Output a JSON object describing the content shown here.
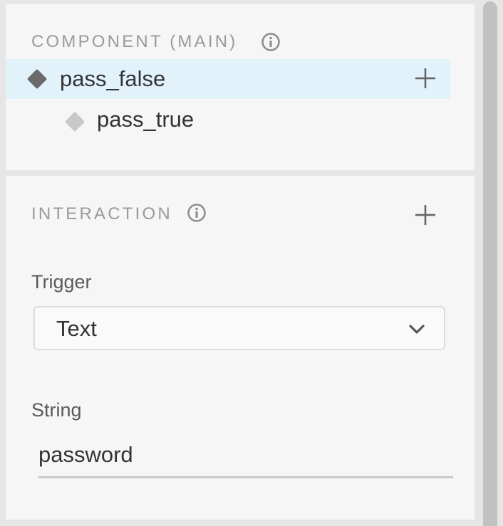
{
  "component_section": {
    "title": "COMPONENT (MAIN)",
    "items": [
      {
        "label": "pass_false",
        "selected": true,
        "icon": "diamond-filled-icon"
      },
      {
        "label": "pass_true",
        "selected": false,
        "icon": "diamond-light-icon"
      }
    ]
  },
  "interaction_section": {
    "title": "INTERACTION",
    "trigger": {
      "label": "Trigger",
      "value": "Text"
    },
    "string": {
      "label": "String",
      "value": "password"
    }
  },
  "colors": {
    "selected_row": "#e1f2fb",
    "panel_bg": "#f6f6f6",
    "outer_bg": "#e6e6e6"
  }
}
